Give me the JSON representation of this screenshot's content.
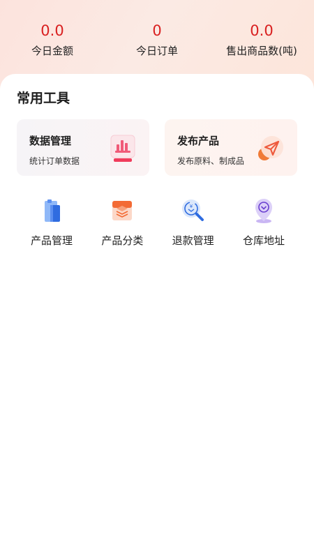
{
  "stats": [
    {
      "value": "0.0",
      "label": "今日金额"
    },
    {
      "value": "0",
      "label": "今日订单"
    },
    {
      "value": "0.0",
      "label": "售出商品数(吨)"
    }
  ],
  "section": {
    "title": "常用工具"
  },
  "cards": [
    {
      "title": "数据管理",
      "subtitle": "统计订单数据",
      "icon": "data-chart-icon"
    },
    {
      "title": "发布产品",
      "subtitle": "发布原料、制成品",
      "icon": "send-icon"
    }
  ],
  "tools": [
    {
      "label": "产品管理",
      "icon": "product-management-icon"
    },
    {
      "label": "产品分类",
      "icon": "product-category-icon"
    },
    {
      "label": "退款管理",
      "icon": "refund-icon"
    },
    {
      "label": "仓库地址",
      "icon": "warehouse-location-icon"
    }
  ],
  "colors": {
    "stat_value": "#d92020",
    "accent": "#ee5a3c"
  }
}
